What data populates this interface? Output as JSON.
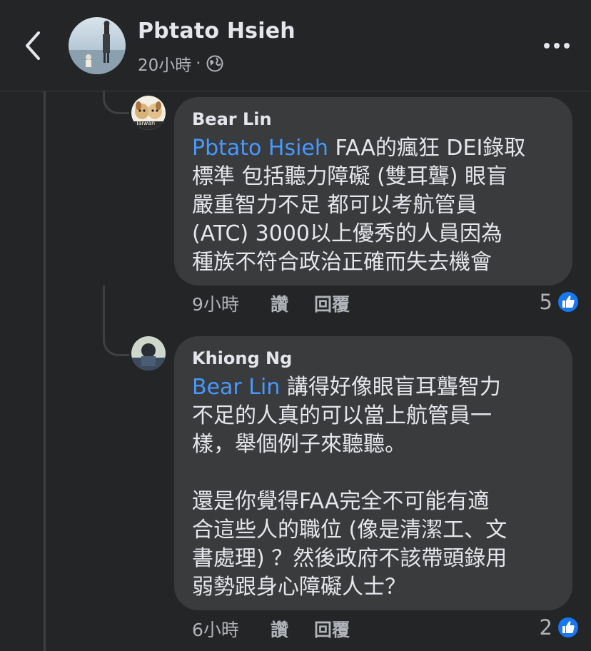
{
  "post": {
    "author": "Pbtato Hsieh",
    "time": "20小時",
    "separator": "·"
  },
  "comments": [
    {
      "author": "Bear Lin",
      "avatar_text": "Taiwan",
      "mention": "Pbtato Hsieh",
      "text": " FAA的瘋狂 DEI錄取\n標準 包括聽力障礙 (雙耳聾) 眼盲\n嚴重智力不足 都可以考航管員\n(ATC) 3000以上優秀的人員因為\n種族不符合政治正確而失去機會",
      "time": "9小時",
      "like_label": "讚",
      "reply_label": "回覆",
      "reactions": "5"
    },
    {
      "author": "Khiong Ng",
      "mention": "Bear Lin",
      "text": " 講得好像眼盲耳聾智力\n不足的人真的可以當上航管員一\n樣，舉個例子來聽聽。\n\n還是你覺得FAA完全不可能有適\n合這些人的職位 (像是清潔工、文\n書處理) ？然後政府不該帶頭錄用\n弱勢跟身心障礙人士？",
      "time": "6小時",
      "like_label": "讚",
      "reply_label": "回覆",
      "reactions": "2"
    }
  ],
  "colors": {
    "background": "#242526",
    "bubble": "#3a3b3c",
    "mention": "#4599ff",
    "like_badge": "#1877f2"
  },
  "icons": [
    "back-chevron-icon",
    "globe-icon",
    "more-dots-icon",
    "like-thumb-icon"
  ]
}
